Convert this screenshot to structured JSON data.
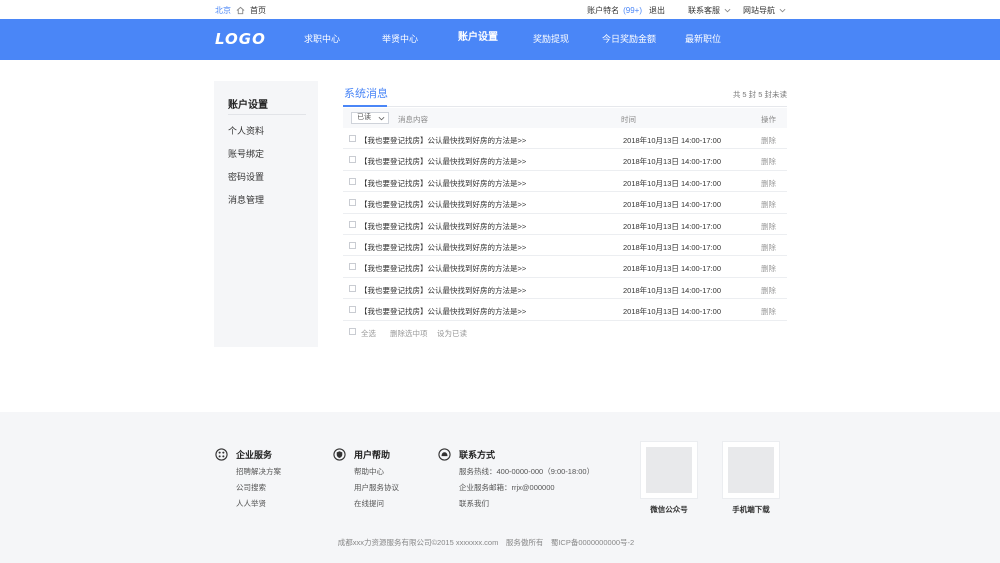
{
  "topbar": {
    "city": "北京",
    "home": "首页",
    "account": "账户特名",
    "count": "(99+)",
    "logout": "退出",
    "service": "联系客服",
    "site_nav": "网站导航"
  },
  "nav": {
    "logo": "LOGO",
    "items": [
      "求职中心",
      "举贤中心",
      "账户设置",
      "奖励提现",
      "今日奖励金额",
      "最新职位"
    ],
    "active_index": 2
  },
  "sidebar": {
    "title": "账户设置",
    "items": [
      "个人资料",
      "账号绑定",
      "密码设置",
      "消息管理"
    ]
  },
  "main": {
    "tab": "系统消息",
    "summary": "共 5 封 5 封未读",
    "filter_value": "已读",
    "col_content": "消息内容",
    "col_time": "时间",
    "col_action": "操作",
    "rows": [
      {
        "msg": "【我也要登记找房】公认最快找到好房的方法是>>",
        "time": "2018年10月13日 14:00-17:00",
        "action": "删除"
      },
      {
        "msg": "【我也要登记找房】公认最快找到好房的方法是>>",
        "time": "2018年10月13日 14:00-17:00",
        "action": "删除"
      },
      {
        "msg": "【我也要登记找房】公认最快找到好房的方法是>>",
        "time": "2018年10月13日 14:00-17:00",
        "action": "删除"
      },
      {
        "msg": "【我也要登记找房】公认最快找到好房的方法是>>",
        "time": "2018年10月13日 14:00-17:00",
        "action": "删除"
      },
      {
        "msg": "【我也要登记找房】公认最快找到好房的方法是>>",
        "time": "2018年10月13日 14:00-17:00",
        "action": "删除"
      },
      {
        "msg": "【我也要登记找房】公认最快找到好房的方法是>>",
        "time": "2018年10月13日 14:00-17:00",
        "action": "删除"
      },
      {
        "msg": "【我也要登记找房】公认最快找到好房的方法是>>",
        "time": "2018年10月13日 14:00-17:00",
        "action": "删除"
      },
      {
        "msg": "【我也要登记找房】公认最快找到好房的方法是>>",
        "time": "2018年10月13日 14:00-17:00",
        "action": "删除"
      },
      {
        "msg": "【我也要登记找房】公认最快找到好房的方法是>>",
        "time": "2018年10月13日 14:00-17:00",
        "action": "删除"
      }
    ],
    "select_all": "全选",
    "delete_selected": "删除选中项",
    "mark_read": "设为已读"
  },
  "footer": {
    "enterprise": {
      "title": "企业服务",
      "icon": "grid-icon",
      "links": [
        "招聘解决方案",
        "公司搜索",
        "人人举贤"
      ]
    },
    "help": {
      "title": "用户帮助",
      "icon": "shield-icon",
      "links": [
        "帮助中心",
        "用户服务协议",
        "在线提问"
      ]
    },
    "contact": {
      "title": "联系方式",
      "icon": "chat-icon",
      "links": [
        "服务热线：400-0000-000（9:00-18:00）",
        "企业服务邮箱：rrjx@000000",
        "联系我们"
      ]
    },
    "qr_wechat": "微信公众号",
    "qr_app": "手机端下载",
    "copyright": "成都xxx力资源服务有限公司©2015 xxxxxxx.com　服务傲所有　蜀ICP备0000000000号-2"
  },
  "colors": {
    "brand": "#4a86f7",
    "footer_bg": "#f5f6f8",
    "sidebar_bg": "#f5f6f8"
  }
}
